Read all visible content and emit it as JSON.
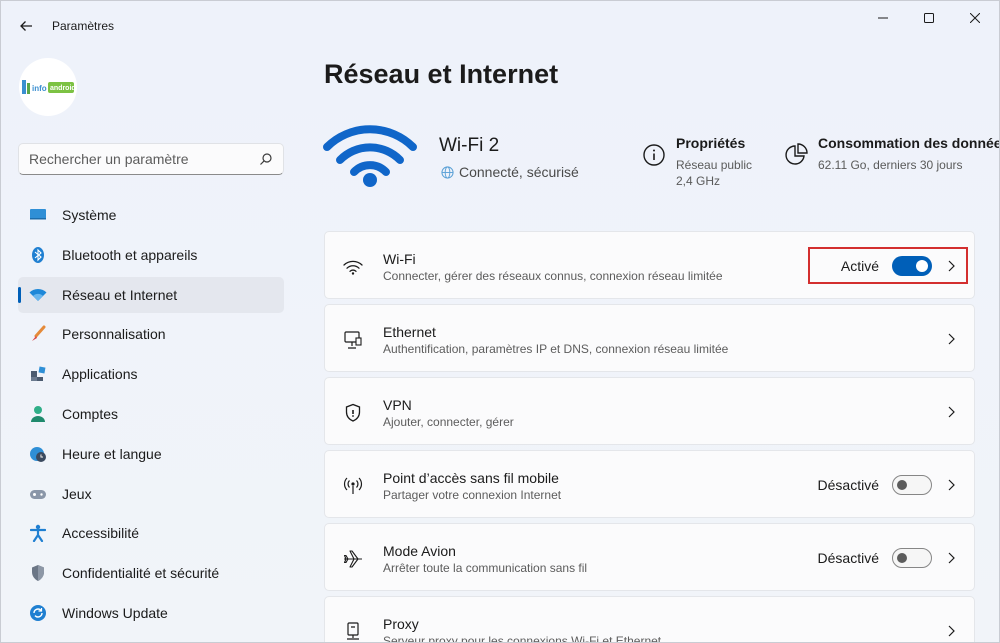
{
  "window": {
    "title": "Paramètres"
  },
  "sidebar": {
    "logo_text": "info-android",
    "search_placeholder": "Rechercher un paramètre",
    "items": [
      {
        "label": "Système",
        "icon": "monitor-icon"
      },
      {
        "label": "Bluetooth et appareils",
        "icon": "bluetooth-icon"
      },
      {
        "label": "Réseau et Internet",
        "icon": "wifi-icon",
        "selected": true
      },
      {
        "label": "Personnalisation",
        "icon": "brush-icon"
      },
      {
        "label": "Applications",
        "icon": "apps-icon"
      },
      {
        "label": "Comptes",
        "icon": "person-icon"
      },
      {
        "label": "Heure et langue",
        "icon": "globe-clock-icon"
      },
      {
        "label": "Jeux",
        "icon": "gamepad-icon"
      },
      {
        "label": "Accessibilité",
        "icon": "accessibility-icon"
      },
      {
        "label": "Confidentialité et sécurité",
        "icon": "shield-icon"
      },
      {
        "label": "Windows Update",
        "icon": "update-icon"
      }
    ]
  },
  "main": {
    "title": "Réseau et Internet",
    "connection": {
      "name": "Wi-Fi 2",
      "status": "Connecté, sécurisé"
    },
    "properties": {
      "title": "Propriétés",
      "line1": "Réseau public",
      "line2": "2,4 GHz"
    },
    "usage": {
      "title": "Consommation des données",
      "line1": "62.11 Go, derniers 30 jours"
    },
    "cards": [
      {
        "title": "Wi-Fi",
        "subtitle": "Connecter, gérer des réseaux connus, connexion réseau limitée",
        "icon": "wifi-icon",
        "state": "Activé",
        "toggle": true
      },
      {
        "title": "Ethernet",
        "subtitle": "Authentification, paramètres IP et DNS, connexion réseau limitée",
        "icon": "ethernet-icon"
      },
      {
        "title": "VPN",
        "subtitle": "Ajouter, connecter, gérer",
        "icon": "vpn-shield-icon"
      },
      {
        "title": "Point d’accès sans fil mobile",
        "subtitle": "Partager votre connexion Internet",
        "icon": "hotspot-icon",
        "state": "Désactivé",
        "toggle": false
      },
      {
        "title": "Mode Avion",
        "subtitle": "Arrêter toute la communication sans fil",
        "icon": "airplane-icon",
        "state": "Désactivé",
        "toggle": false
      },
      {
        "title": "Proxy",
        "subtitle": "Serveur proxy pour les connexions Wi-Fi et Ethernet",
        "icon": "proxy-icon"
      }
    ]
  },
  "colors": {
    "accent": "#005fb8",
    "highlight": "#d32f2f"
  }
}
